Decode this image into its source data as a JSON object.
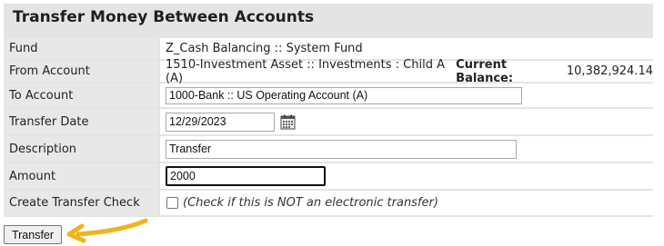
{
  "form": {
    "title": "Transfer Money Between Accounts",
    "fund": {
      "label": "Fund",
      "value": "Z_Cash Balancing :: System Fund"
    },
    "from_account": {
      "label": "From Account",
      "value": "1510-Investment Asset :: Investments : Child A (A)",
      "balance_label": "Current Balance:",
      "balance_value": "10,382,924.14"
    },
    "to_account": {
      "label": "To Account",
      "value": "1000-Bank :: US Operating Account (A)"
    },
    "transfer_date": {
      "label": "Transfer Date",
      "value": "12/29/2023",
      "icon": "calendar-icon"
    },
    "description": {
      "label": "Description",
      "value": "Transfer"
    },
    "amount": {
      "label": "Amount",
      "value": "2000"
    },
    "transfer_check": {
      "label": "Create Transfer Check",
      "checked": false,
      "note": "(Check if this is NOT an electronic transfer)"
    },
    "submit_label": "Transfer"
  },
  "annotation": {
    "arrow_color": "#f0b41c",
    "icon": "arrow-left-icon"
  }
}
